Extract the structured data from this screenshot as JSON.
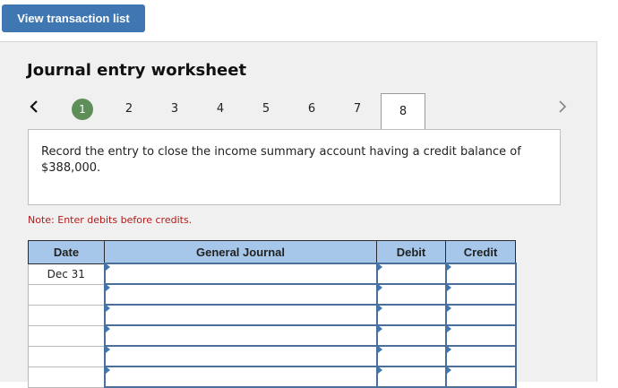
{
  "header": {
    "view_transactions_label": "View transaction list"
  },
  "worksheet": {
    "title": "Journal entry worksheet",
    "tabs": [
      {
        "label": "1",
        "state": "active"
      },
      {
        "label": "2"
      },
      {
        "label": "3"
      },
      {
        "label": "4"
      },
      {
        "label": "5"
      },
      {
        "label": "6"
      },
      {
        "label": "7"
      },
      {
        "label": "8",
        "state": "selected"
      }
    ],
    "instruction": "Record the entry to close the income summary account having a credit balance of $388,000.",
    "note": "Note: Enter debits before credits.",
    "table": {
      "headers": {
        "date": "Date",
        "journal": "General Journal",
        "debit": "Debit",
        "credit": "Credit"
      },
      "rows": [
        {
          "date": "Dec 31",
          "journal": "",
          "debit": "",
          "credit": ""
        },
        {
          "date": "",
          "journal": "",
          "debit": "",
          "credit": ""
        },
        {
          "date": "",
          "journal": "",
          "debit": "",
          "credit": ""
        },
        {
          "date": "",
          "journal": "",
          "debit": "",
          "credit": ""
        },
        {
          "date": "",
          "journal": "",
          "debit": "",
          "credit": ""
        },
        {
          "date": "",
          "journal": "",
          "debit": "",
          "credit": ""
        }
      ]
    }
  },
  "icons": {
    "prev": "chevron-left-icon",
    "next": "chevron-right-icon"
  },
  "colors": {
    "accent": "#3f77b3",
    "active_tab": "#5f8f58",
    "header_fill": "#a6c7e9",
    "note": "#b31b1b"
  }
}
